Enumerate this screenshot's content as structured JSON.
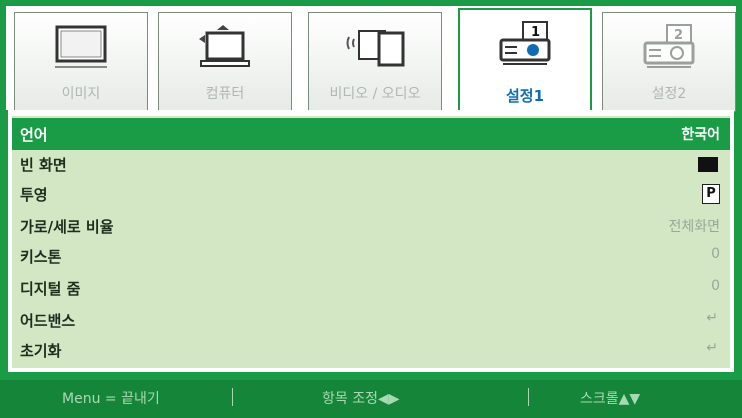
{
  "tabs": [
    {
      "label": "이미지",
      "icon": "monitor-icon",
      "active": false
    },
    {
      "label": "컴퓨터",
      "icon": "computer-icon",
      "active": false
    },
    {
      "label": "비디오 / 오디오",
      "icon": "video-audio-icon",
      "active": false
    },
    {
      "label": "설정1",
      "icon": "projector-setup1-icon",
      "active": true
    },
    {
      "label": "설정2",
      "icon": "projector-setup2-icon",
      "active": false
    }
  ],
  "menu": [
    {
      "label": "언어",
      "value": "한국어"
    },
    {
      "label": "빈 화면",
      "value_icon": "black-square-icon"
    },
    {
      "label": "투영",
      "value": "P"
    },
    {
      "label": "가로/세로 비율",
      "value": "전체화면"
    },
    {
      "label": "키스톤",
      "value": "0"
    },
    {
      "label": "디지털 줌",
      "value": "0"
    },
    {
      "label": "어드밴스",
      "value_icon": "enter-icon"
    },
    {
      "label": "초기화",
      "value_icon": "enter-icon"
    }
  ],
  "footer": {
    "menu_hint": "Menu = 끝내기",
    "adjust_hint": "항목 조정◀▶",
    "scroll_hint": "스크롤▲▼"
  },
  "colors": {
    "frame_green": "#1a9b46",
    "row_bg": "#d4e7c4",
    "active_tab_text": "#0e6db4"
  }
}
